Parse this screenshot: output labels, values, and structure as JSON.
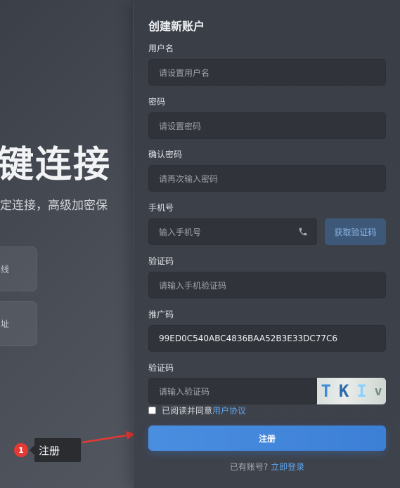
{
  "background": {
    "hero_title": "键连接",
    "hero_subtitle": "定连接，高级加密保",
    "cards": [
      {
        "text": "线"
      },
      {
        "text": "址"
      }
    ]
  },
  "annotation": {
    "badge": "1",
    "label": "注册"
  },
  "form": {
    "title": "创建新账户",
    "username": {
      "label": "用户名",
      "placeholder": "请设置用户名"
    },
    "password": {
      "label": "密码",
      "placeholder": "请设置密码"
    },
    "confirm_password": {
      "label": "确认密码",
      "placeholder": "请再次输入密码"
    },
    "phone": {
      "label": "手机号",
      "placeholder": "输入手机号",
      "icon": "phone-icon"
    },
    "get_code_button": "获取验证码",
    "sms_code": {
      "label": "验证码",
      "placeholder": "请输入手机验证码"
    },
    "referral": {
      "label": "推广码",
      "value": "99ED0C540ABC4836BAA52B3E33DC77C6"
    },
    "captcha": {
      "label": "验证码",
      "placeholder": "请输入验证码",
      "image_text": [
        "T",
        "K",
        "I",
        "v"
      ]
    },
    "agree": {
      "text": "已阅读并同意",
      "link": "用户协议"
    },
    "submit_button": "注册",
    "login_prompt": {
      "text": "已有账号?",
      "link": "立即登录"
    }
  },
  "colors": {
    "accent": "#4a8ee0",
    "link": "#5ea3ec",
    "annotation_red": "#e53935"
  }
}
